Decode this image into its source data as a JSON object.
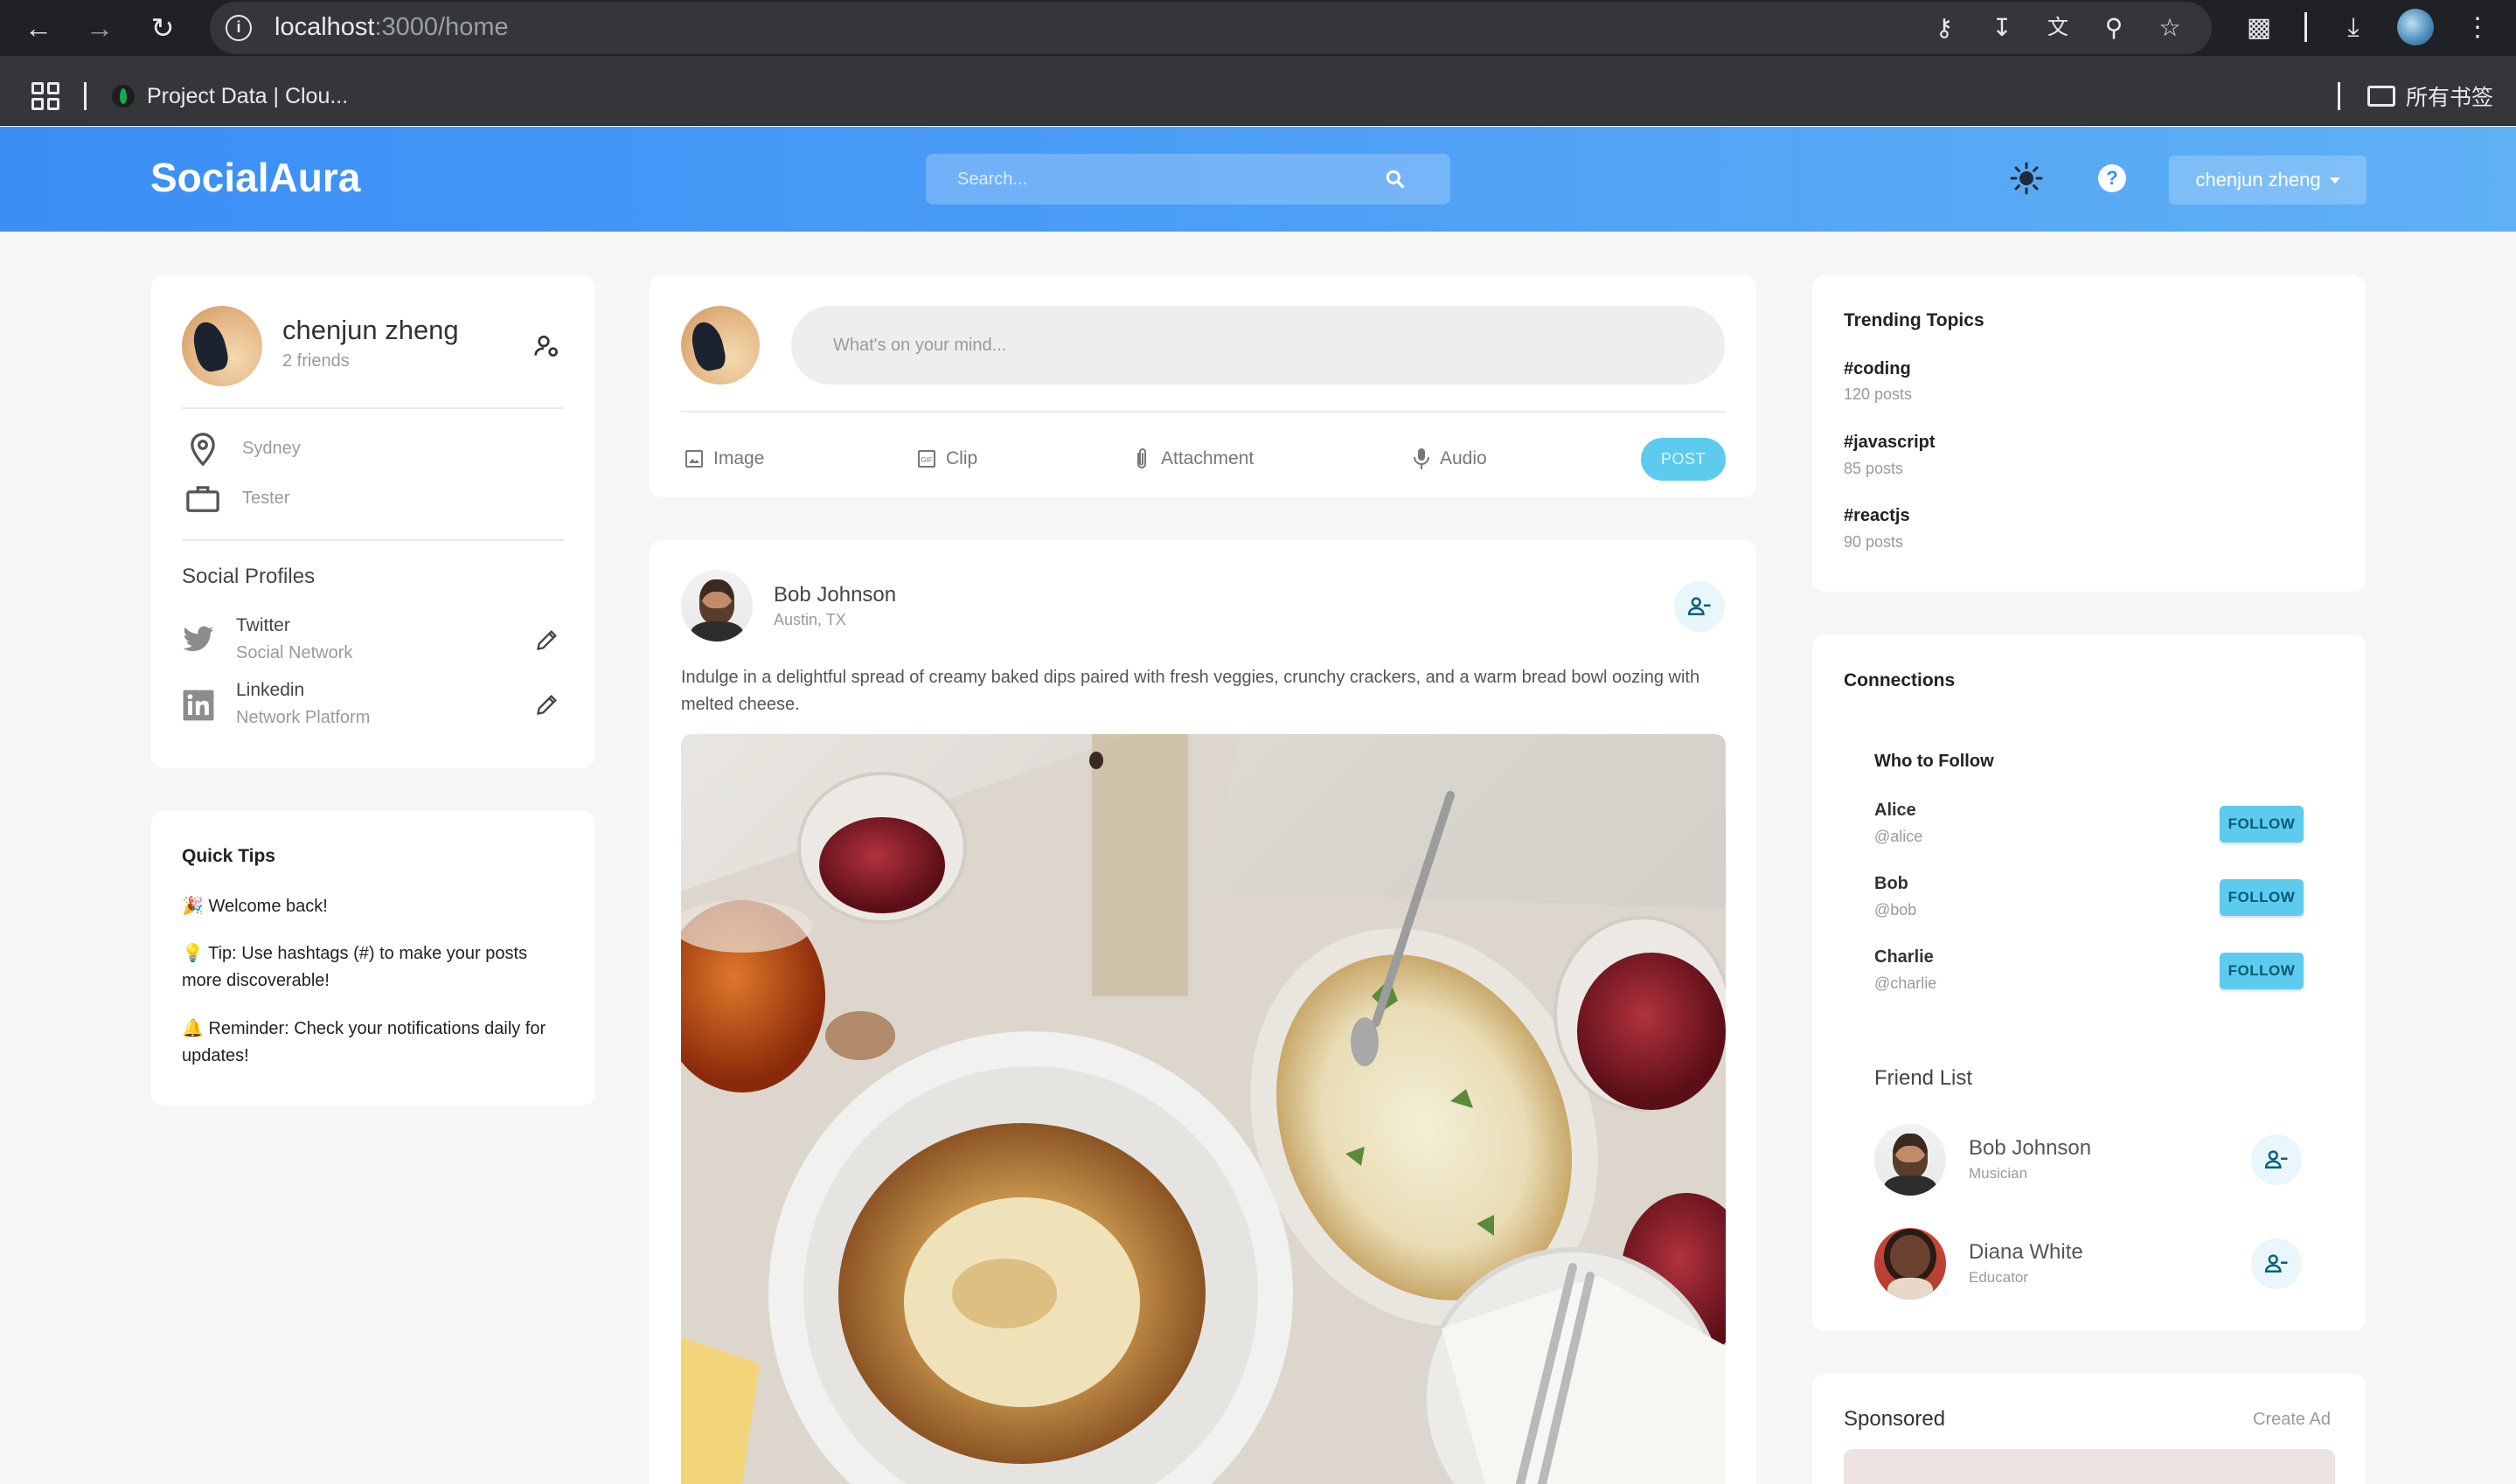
{
  "browser": {
    "url_host": "localhost",
    "url_path": ":3000/home",
    "bookmark_label": "Project Data | Clou...",
    "all_bookmarks_label": "所有书签"
  },
  "header": {
    "brand": "SocialAura",
    "search_placeholder": "Search...",
    "user_menu_label": "chenjun zheng"
  },
  "profile": {
    "name": "chenjun zheng",
    "friends": "2 friends",
    "location": "Sydney",
    "occupation": "Tester",
    "social_title": "Social Profiles",
    "socials": [
      {
        "name": "Twitter",
        "type": "Social Network"
      },
      {
        "name": "Linkedin",
        "type": "Network Platform"
      }
    ]
  },
  "tips": {
    "title": "Quick Tips",
    "items": [
      "🎉 Welcome back!",
      "💡 Tip: Use hashtags (#) to make your posts more discoverable!",
      "🔔 Reminder: Check your notifications daily for updates!"
    ]
  },
  "composer": {
    "placeholder": "What's on your mind...",
    "tools": [
      "Image",
      "Clip",
      "Attachment",
      "Audio"
    ],
    "post_label": "POST"
  },
  "post": {
    "author": "Bob Johnson",
    "location": "Austin, TX",
    "text": "Indulge in a delightful spread of creamy baked dips paired with fresh veggies, crunchy crackers, and a warm bread bowl oozing with melted cheese."
  },
  "trending": {
    "title": "Trending Topics",
    "topics": [
      {
        "tag": "#coding",
        "count": "120 posts"
      },
      {
        "tag": "#javascript",
        "count": "85 posts"
      },
      {
        "tag": "#reactjs",
        "count": "90 posts"
      }
    ]
  },
  "connections": {
    "title": "Connections",
    "who_to_follow_title": "Who to Follow",
    "suggestions": [
      {
        "name": "Alice",
        "handle": "@alice"
      },
      {
        "name": "Bob",
        "handle": "@bob"
      },
      {
        "name": "Charlie",
        "handle": "@charlie"
      }
    ],
    "follow_label": "FOLLOW",
    "friend_list_title": "Friend List",
    "friends": [
      {
        "name": "Bob Johnson",
        "role": "Musician"
      },
      {
        "name": "Diana White",
        "role": "Educator"
      }
    ]
  },
  "sponsored": {
    "title": "Sponsored",
    "create_ad_label": "Create Ad"
  },
  "colors": {
    "header_gradient_start": "#3a8ef6",
    "header_gradient_end": "#5fb0f5",
    "accent": "#5ccbee",
    "page_background": "#f6f6f6"
  }
}
